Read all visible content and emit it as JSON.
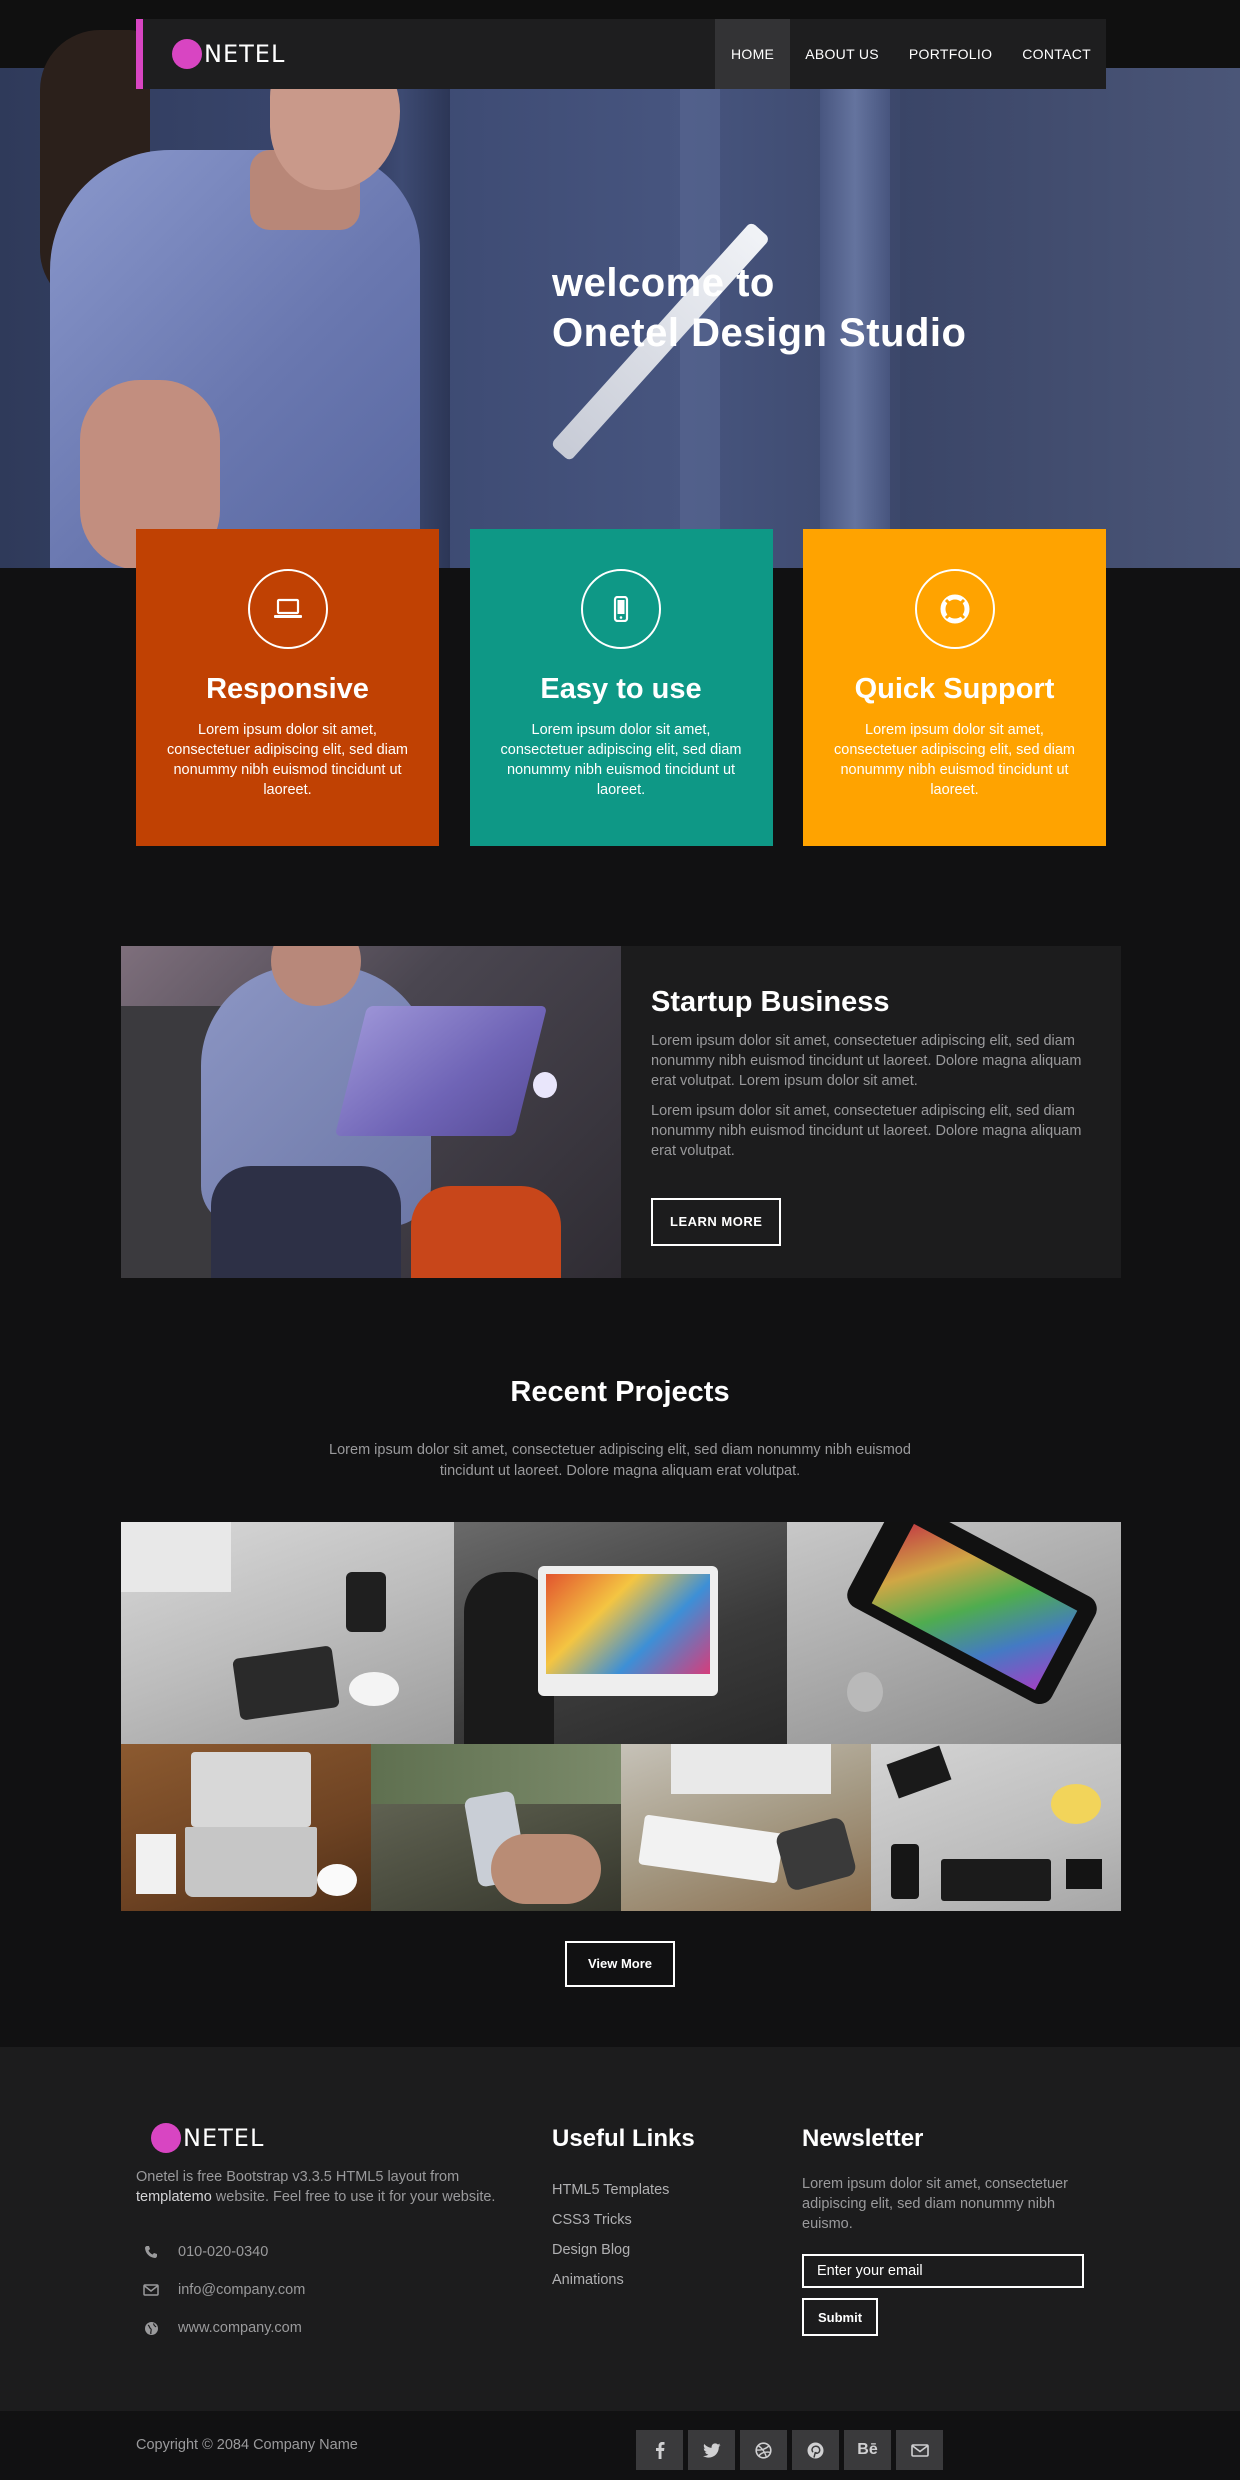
{
  "brand": {
    "logo_text": "NETEL",
    "accent_color": "#d845c2"
  },
  "nav": {
    "items": [
      {
        "label": "HOME",
        "active": true
      },
      {
        "label": "ABOUT US",
        "active": false
      },
      {
        "label": "PORTFOLIO",
        "active": false
      },
      {
        "label": "CONTACT",
        "active": false
      }
    ]
  },
  "hero": {
    "title_line1": "welcome to",
    "title_line2": "Onetel Design Studio"
  },
  "features": [
    {
      "title": "Responsive",
      "icon": "laptop-icon",
      "color": "#c04103",
      "text": "Lorem ipsum dolor sit amet, consectetuer adipiscing elit, sed diam nonummy nibh euismod tincidunt ut laoreet."
    },
    {
      "title": "Easy to use",
      "icon": "mobile-icon",
      "color": "#0e9886",
      "text": "Lorem ipsum dolor sit amet, consectetuer adipiscing elit, sed diam nonummy nibh euismod tincidunt ut laoreet."
    },
    {
      "title": "Quick Support",
      "icon": "life-ring-icon",
      "color": "#ffa300",
      "text": "Lorem ipsum dolor sit amet, consectetuer adipiscing elit, sed diam nonummy nibh euismod tincidunt ut laoreet."
    }
  ],
  "startup": {
    "title": "Startup Business",
    "para1": "Lorem ipsum dolor sit amet, consectetuer adipiscing elit, sed diam nonummy nibh euismod tincidunt ut laoreet. Dolore magna aliquam erat volutpat. Lorem ipsum dolor sit amet.",
    "para2": "Lorem ipsum dolor sit amet, consectetuer adipiscing elit, sed diam nonummy nibh euismod tincidunt ut laoreet. Dolore magna aliquam erat volutpat.",
    "button_label": "LEARN MORE"
  },
  "projects": {
    "title": "Recent Projects",
    "description": "Lorem ipsum dolor sit amet, consectetuer adipiscing elit, sed diam nonummy nibh euismod tincidunt ut laoreet. Dolore magna aliquam erat volutpat.",
    "view_more_label": "View More"
  },
  "footer": {
    "about_prefix": "Onetel is free Bootstrap v3.3.5 HTML5 layout from ",
    "about_link": "templatemo",
    "about_suffix": " website. Feel free to use it for your website.",
    "phone": "010-020-0340",
    "email": "info@company.com",
    "website": "www.company.com",
    "useful_links_title": "Useful Links",
    "useful_links": [
      "HTML5 Templates",
      "CSS3 Tricks",
      "Design Blog",
      "Animations"
    ],
    "newsletter_title": "Newsletter",
    "newsletter_text": "Lorem ipsum dolor sit amet, consectetuer adipiscing elit, sed diam nonummy nibh euismo.",
    "email_placeholder": "Enter your email",
    "submit_label": "Submit",
    "copyright": "Copyright © 2084 Company Name",
    "socials": [
      "facebook-icon",
      "twitter-icon",
      "dribbble-icon",
      "pinterest-icon",
      "behance-icon",
      "envelope-icon"
    ],
    "behance_glyph": "Bē"
  }
}
